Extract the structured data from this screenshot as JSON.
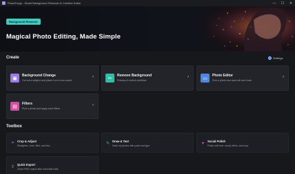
{
  "window": {
    "title": "PhotoForge - Smart Background Remover & Creative Editor",
    "controls": [
      "—",
      "☐",
      "✕"
    ]
  },
  "hero": {
    "badge": "Background Remover",
    "title": "Magical Photo Editing, Made Simple",
    "accent": "#3fc9bf"
  },
  "create": {
    "heading": "Create",
    "settings_label": "Settings",
    "cards": [
      {
        "title": "Background Change",
        "desc": "Cut out a subject and place it on a new scene",
        "icon": "image-icon",
        "icon_color": "#9c7be8",
        "chevron": "›"
      },
      {
        "title": "Remove Background",
        "desc": "Primary AI cutout workflow",
        "icon": "scissors-icon",
        "icon_color": "#2fbfa7",
        "chevron": "›"
      },
      {
        "title": "Photo Editor",
        "desc": "Pick a photo and open all core tools",
        "icon": "folder-icon",
        "icon_color": "#4f86e0",
        "chevron": "›"
      },
      {
        "title": "Filters",
        "desc": "Pick a photo and apply color filters",
        "icon": "filters-icon",
        "icon_color": "#d24fa0",
        "chevron": "›"
      }
    ]
  },
  "toolbox": {
    "heading": "Toolbox",
    "tools": [
      {
        "title": "Crop & Adjust",
        "desc": "Straighten, tune, filter, and blur",
        "icon": "crop-icon",
        "icon_color": "#4a8cff"
      },
      {
        "title": "Draw & Text",
        "desc": "Mark up photos with paint and type",
        "icon": "pen-icon",
        "icon_color": "#3fc98a"
      },
      {
        "title": "Social Polish",
        "desc": "Finish with text, emoji, filters, and crop",
        "icon": "sparkle-icon",
        "icon_color": "#d75fd0"
      },
      {
        "title": "Quick Export",
        "desc": "Clean PNG output after essential edits",
        "icon": "export-icon",
        "icon_color": "#f0b23a"
      }
    ]
  }
}
